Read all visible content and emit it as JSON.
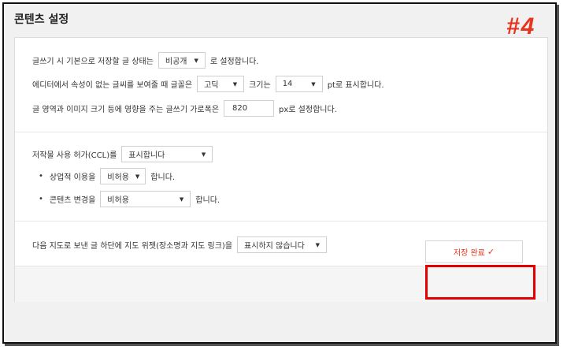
{
  "title": "콘텐츠 설정",
  "step_tag": "#4",
  "section1": {
    "row1": {
      "text_before": "글쓰기 시 기본으로 저장할 글 상태는",
      "select_value": "비공개",
      "text_after": "로 설정합니다."
    },
    "row2": {
      "text_before": "에디터에서 속성이 없는 글씨를 보여줄 때 글꼴은",
      "font_select": "고딕",
      "text_mid": "크기는",
      "size_select": "14",
      "text_after": "pt로 표시합니다."
    },
    "row3": {
      "text_before": "글 영역과 이미지 크기 등에 영향을 주는 글쓰기 가로폭은",
      "width_value": "820",
      "text_after": "px로 설정합니다."
    }
  },
  "section2": {
    "row1": {
      "text_before": "저작물 사용 허가(CCL)를",
      "select_value": "표시합니다"
    },
    "row2": {
      "bullet": "•",
      "text_before": "상업적 이용을",
      "select_value": "비허용",
      "text_after": "합니다."
    },
    "row3": {
      "bullet": "•",
      "text_before": "콘텐츠 변경을",
      "select_value": "비허용",
      "text_after": "합니다."
    }
  },
  "section3": {
    "row1": {
      "text_before": "다음 지도로 보낸 글 하단에 지도 위젯(장소명과 지도 링크)을",
      "select_value": "표시하지 않습니다"
    }
  },
  "save_button": {
    "label": "저장 완료",
    "check": "✓"
  },
  "colors": {
    "accent": "#e8341c",
    "highlight": "#e30000"
  },
  "icons": {
    "caret": "dropdown-caret-icon",
    "check": "check-icon"
  }
}
